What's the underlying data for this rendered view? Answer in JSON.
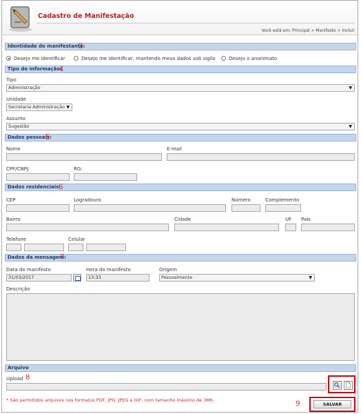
{
  "header": {
    "title": "Cadastro de Manifestação",
    "breadcrumb": "Você está em: Principal > Manifesto > Incluir"
  },
  "annotations": [
    "3",
    "4",
    "5",
    "6",
    "7",
    "8",
    "9"
  ],
  "sections": {
    "identidade": "Identidade do manifestante:",
    "tipo_info": "Tipo de informação:",
    "dados_pessoais": "Dados pessoais:",
    "dados_residenciais": "Dados residenciais:",
    "dados_mensagem": "Dados da mensagem:",
    "arquivo": "Arquivo"
  },
  "identity_options": [
    {
      "label": "Desejo me identificar",
      "selected": true
    },
    {
      "label": "Desejo me identificar, mantendo meus dados sob sigilo",
      "selected": false
    },
    {
      "label": "Desejo o anonimato",
      "selected": false
    }
  ],
  "tipo": {
    "label": "Tipo",
    "value": "Administração"
  },
  "unidade": {
    "label": "Unidade",
    "value": "Secretaria Administração"
  },
  "assunto": {
    "label": "Assunto",
    "value": "Sugestão"
  },
  "pessoais": {
    "nome": "Nome",
    "email": "E-mail",
    "cpf": "CPF/CNPJ:",
    "rg": "RG:"
  },
  "residenciais": {
    "cep": "CEP",
    "logradouro": "Logradouro",
    "numero": "Número",
    "complemento": "Complemento",
    "bairro": "Bairro",
    "cidade": "Cidade",
    "uf": "UF",
    "pais": "País",
    "telefone": "Telefone",
    "celular": "Celular"
  },
  "mensagem": {
    "data_label": "Data do manifesto",
    "data_value": "31/03/2017",
    "hora_label": "Hora do manifesto",
    "hora_value": "13:33",
    "origem_label": "Origem",
    "origem_value": "Pessoalmente",
    "descricao_label": "Descrição"
  },
  "arquivo": {
    "upload_label": "Upload"
  },
  "note": "* São permitidos arquivos nos formatos PDF, JPG, JPEG e GIF, com tamanho máximo de 3Mb.",
  "save_label": "SALVAR",
  "icons": {
    "logo": "pen-document-logo-icon",
    "calendar": "calendar-icon",
    "search": "magnifier-icon",
    "file": "document-icon",
    "dropdown": "triangle-down-icon"
  }
}
